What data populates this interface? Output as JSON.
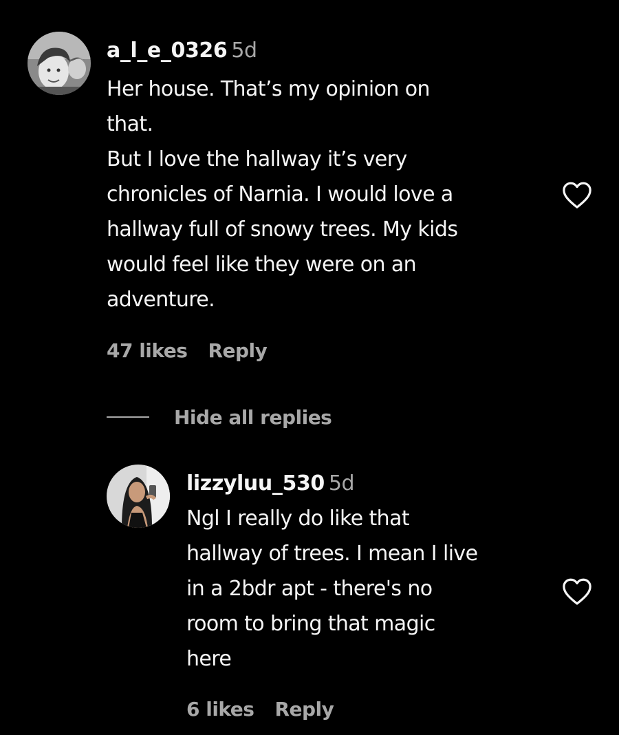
{
  "comments": [
    {
      "username": "a_l_e_0326",
      "time": "5d",
      "lines": [
        "Her house. That’s my opinion on",
        "that.",
        "But I love the hallway it’s very",
        "chronicles of Narnia. I would love a",
        "hallway full of snowy trees. My kids",
        "would feel like they were on an",
        "adventure."
      ],
      "likes": "47 likes",
      "reply_label": "Reply",
      "like_icon": "heart-outline-icon"
    },
    {
      "username": "lizzyluu_530",
      "time": "5d",
      "lines": [
        "Ngl I really do like that",
        "hallway of trees. I mean I live",
        "in a 2bdr apt - there's no",
        "room to bring that magic",
        "here"
      ],
      "likes": "6 likes",
      "reply_label": "Reply",
      "like_icon": "heart-outline-icon"
    }
  ],
  "thread": {
    "hide_replies_label": "Hide all replies"
  },
  "colors": {
    "background": "#000000",
    "primary_text": "#f5f5f5",
    "secondary_text": "#a8a8a8"
  }
}
